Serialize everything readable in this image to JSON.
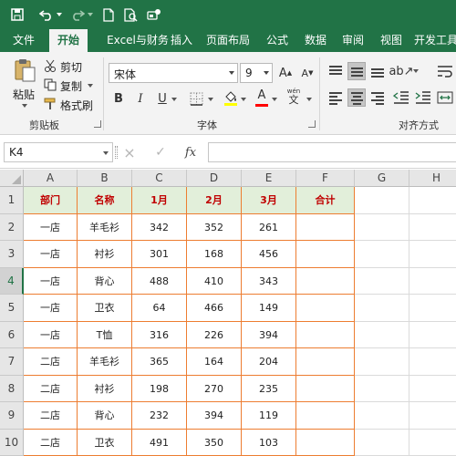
{
  "colors": {
    "brand": "#217346",
    "header_fill": "#e2efda",
    "header_text": "#c00000",
    "table_border": "#ed7d31"
  },
  "titlebar": {
    "icons": [
      "save-icon",
      "undo-icon",
      "undo-dropdown-icon",
      "redo-icon",
      "new-file-icon",
      "print-preview-icon",
      "customize-icon"
    ]
  },
  "tabs": [
    "文件",
    "开始",
    "Excel与财务",
    "插入",
    "页面布局",
    "公式",
    "数据",
    "审阅",
    "视图",
    "开发工具"
  ],
  "active_tab": "开始",
  "ribbon": {
    "clipboard": {
      "paste": "粘贴",
      "cut": "剪切",
      "copy": "复制",
      "format_painter": "格式刷",
      "label": "剪贴板"
    },
    "font": {
      "name": "宋体",
      "size": "9",
      "bold": "B",
      "italic": "I",
      "underline": "U",
      "font_color_letter": "A",
      "wen": "wén",
      "label": "字体"
    },
    "alignment": {
      "label": "对齐方式"
    }
  },
  "formula_bar": {
    "name_box": "K4",
    "cancel": "×",
    "enter": "✓",
    "fx": "fx",
    "value": ""
  },
  "sheet": {
    "columns": [
      "A",
      "B",
      "C",
      "D",
      "E",
      "F",
      "G",
      "H"
    ],
    "selected_column": "K",
    "selected_row": "4",
    "rows": [
      {
        "num": "1",
        "cells": [
          "部门",
          "名称",
          "1月",
          "2月",
          "3月",
          "合计"
        ]
      },
      {
        "num": "2",
        "cells": [
          "一店",
          "羊毛衫",
          "342",
          "352",
          "261",
          ""
        ]
      },
      {
        "num": "3",
        "cells": [
          "一店",
          "衬衫",
          "301",
          "168",
          "456",
          ""
        ]
      },
      {
        "num": "4",
        "cells": [
          "一店",
          "背心",
          "488",
          "410",
          "343",
          ""
        ]
      },
      {
        "num": "5",
        "cells": [
          "一店",
          "卫衣",
          "64",
          "466",
          "149",
          ""
        ]
      },
      {
        "num": "6",
        "cells": [
          "一店",
          "T恤",
          "316",
          "226",
          "394",
          ""
        ]
      },
      {
        "num": "7",
        "cells": [
          "二店",
          "羊毛衫",
          "365",
          "164",
          "204",
          ""
        ]
      },
      {
        "num": "8",
        "cells": [
          "二店",
          "衬衫",
          "198",
          "270",
          "235",
          ""
        ]
      },
      {
        "num": "9",
        "cells": [
          "二店",
          "背心",
          "232",
          "394",
          "119",
          ""
        ]
      },
      {
        "num": "10",
        "cells": [
          "二店",
          "卫衣",
          "491",
          "350",
          "103",
          ""
        ]
      }
    ]
  }
}
